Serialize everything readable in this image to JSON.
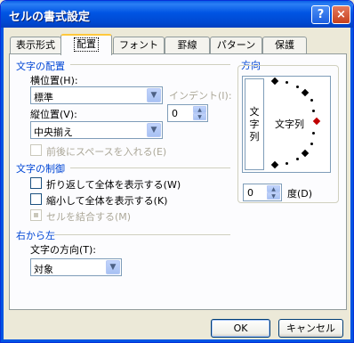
{
  "window": {
    "title": "セルの書式設定",
    "help_label": "?",
    "close_label": "×"
  },
  "tabs": [
    {
      "label": "表示形式"
    },
    {
      "label": "配置"
    },
    {
      "label": "フォント"
    },
    {
      "label": "罫線"
    },
    {
      "label": "パターン"
    },
    {
      "label": "保護"
    }
  ],
  "alignment": {
    "group_title": "文字の配置",
    "horizontal_label": "横位置(H):",
    "horizontal_value": "標準",
    "indent_label": "インデント(I):",
    "indent_value": "0",
    "vertical_label": "縦位置(V):",
    "vertical_value": "中央揃え",
    "distributed_label": "前後にスペースを入れる(E)"
  },
  "text_control": {
    "group_title": "文字の制御",
    "wrap_label": "折り返して全体を表示する(W)",
    "shrink_label": "縮小して全体を表示する(K)",
    "merge_label": "セルを結合する(M)"
  },
  "rtl": {
    "group_title": "右から左",
    "direction_label": "文字の方向(T):",
    "direction_value": "対象"
  },
  "orientation": {
    "group_title": "方向",
    "vertical_text": "文字列",
    "horizontal_text": "文字列",
    "degrees_value": "0",
    "degrees_label": "度(D)"
  },
  "buttons": {
    "ok_label": "OK",
    "cancel_label": "キャンセル"
  },
  "icons": {
    "dropdown": "chevron-down-icon",
    "spin_up": "spin-up-icon",
    "spin_down": "spin-down-icon"
  }
}
